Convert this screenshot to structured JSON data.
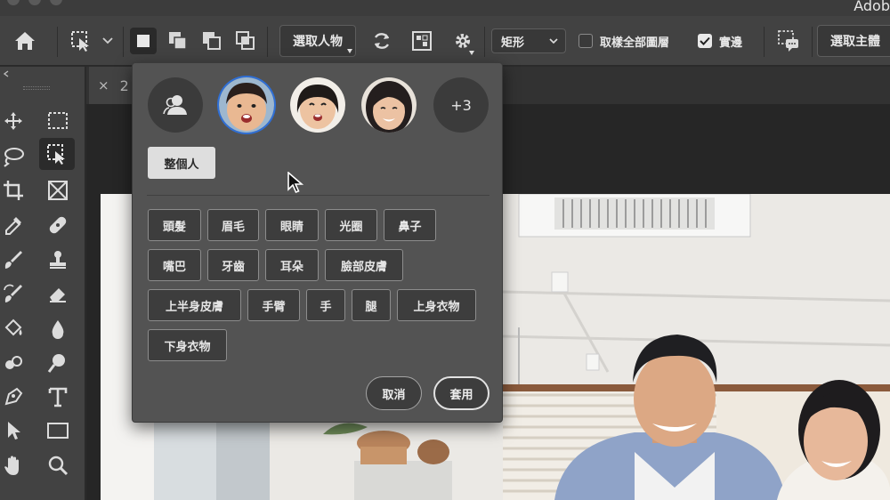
{
  "app": {
    "title": "Adob"
  },
  "options_bar": {
    "subject_button_label": "選取人物",
    "shape_select_value": "矩形",
    "sample_all_layers_label": "取樣全部圖層",
    "sample_all_layers_checked": false,
    "hard_edge_label": "實邊",
    "hard_edge_checked": true,
    "select_subject_label": "選取主體"
  },
  "document": {
    "tab_label": "2"
  },
  "people_panel": {
    "overflow_count": "+3",
    "people": [
      "boy-avatar",
      "girl-avatar",
      "woman-avatar"
    ],
    "active_person_index": 0,
    "whole_person_label": "整個人",
    "parts": [
      [
        "頭髮",
        "眉毛",
        "眼睛",
        "光圈",
        "鼻子"
      ],
      [
        "嘴巴",
        "牙齒",
        "耳朵",
        "臉部皮膚"
      ],
      [
        "上半身皮膚",
        "手臂",
        "手",
        "腿",
        "上身衣物"
      ],
      [
        "下身衣物"
      ]
    ],
    "cancel_label": "取消",
    "apply_label": "套用"
  },
  "colors": {
    "accent_ring": "#2f6fd6",
    "panel_bg": "#535353"
  }
}
